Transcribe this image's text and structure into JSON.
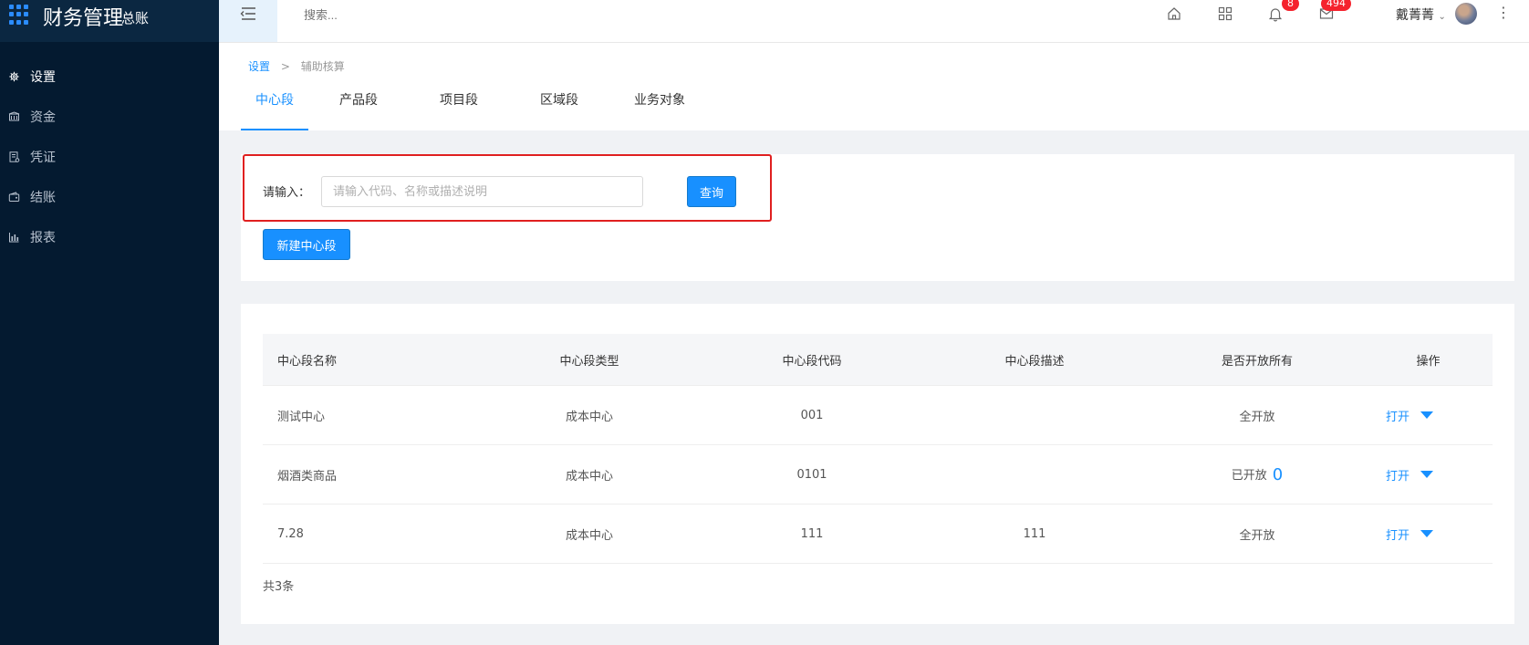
{
  "sidebar": {
    "brand_title": "财务管理",
    "brand_sub": "总账",
    "items": [
      {
        "label": "设置",
        "icon": "gear-icon",
        "active": true
      },
      {
        "label": "资金",
        "icon": "bank-icon",
        "active": false
      },
      {
        "label": "凭证",
        "icon": "voucher-icon",
        "active": false
      },
      {
        "label": "结账",
        "icon": "wallet-icon",
        "active": false
      },
      {
        "label": "报表",
        "icon": "bar-chart-icon",
        "active": false
      }
    ]
  },
  "topbar": {
    "search_placeholder": "搜索...",
    "notifications_count": "8",
    "messages_count": "494",
    "user_name": "戴菁菁"
  },
  "breadcrumb": {
    "root": "设置",
    "separator": ">",
    "current": "辅助核算"
  },
  "tabs": [
    {
      "label": "中心段",
      "active": true
    },
    {
      "label": "产品段",
      "active": false
    },
    {
      "label": "项目段",
      "active": false
    },
    {
      "label": "区域段",
      "active": false
    },
    {
      "label": "业务对象",
      "active": false
    }
  ],
  "search": {
    "label": "请输入：",
    "placeholder": "请输入代码、名称或描述说明",
    "value": "",
    "query_button": "查询",
    "new_button": "新建中心段"
  },
  "table": {
    "headers": [
      "中心段名称",
      "中心段类型",
      "中心段代码",
      "中心段描述",
      "是否开放所有",
      "操作"
    ],
    "rows": [
      {
        "name": "测试中心",
        "type": "成本中心",
        "code": "001",
        "desc": "",
        "open": "全开放",
        "open_count": "",
        "op": "打开"
      },
      {
        "name": "烟酒类商品",
        "type": "成本中心",
        "code": "0101",
        "desc": "",
        "open": "已开放",
        "open_count": "0",
        "op": "打开"
      },
      {
        "name": "7.28",
        "type": "成本中心",
        "code": "111",
        "desc": "111",
        "open": "全开放",
        "open_count": "",
        "op": "打开"
      }
    ],
    "total": "共3条"
  },
  "colors": {
    "sidebar_bg": "#041a30",
    "accent": "#1890ff",
    "highlight": "#e02020",
    "badge": "#f5222d"
  }
}
